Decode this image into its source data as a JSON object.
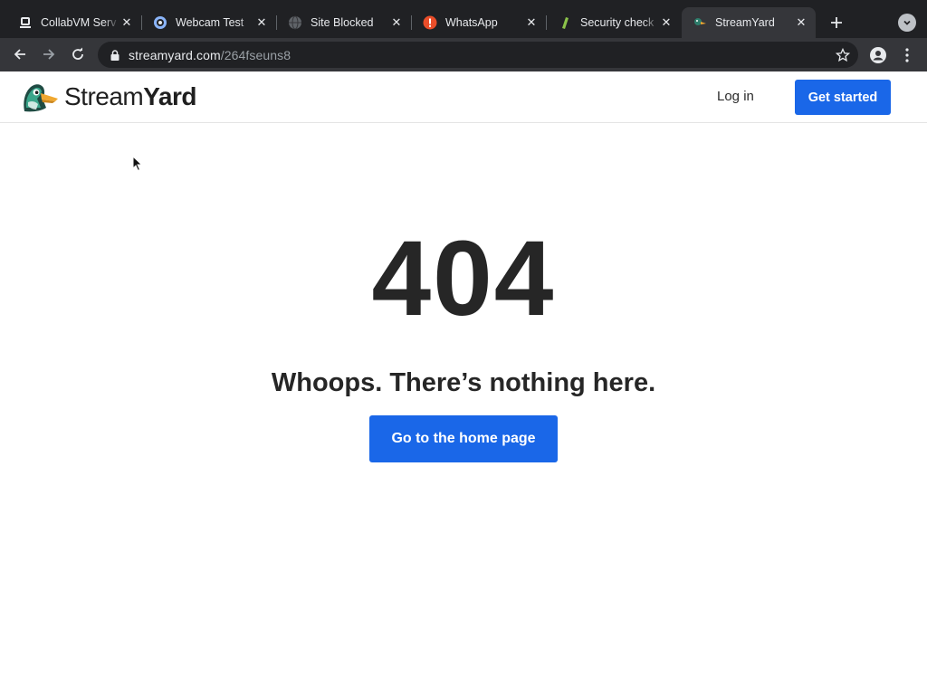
{
  "browser": {
    "tabs": [
      {
        "title": "CollabVM Serv",
        "favicon": "collabvm-icon",
        "active": false
      },
      {
        "title": "Webcam Test",
        "favicon": "webcam-icon",
        "active": false
      },
      {
        "title": "Site Blocked",
        "favicon": "globe-icon",
        "active": false
      },
      {
        "title": "WhatsApp",
        "favicon": "alert-icon",
        "active": false
      },
      {
        "title": "Security check",
        "favicon": "shield-leaf-icon",
        "active": false
      },
      {
        "title": "StreamYard",
        "favicon": "streamyard-icon",
        "active": true
      }
    ],
    "url": {
      "domain": "streamyard.com",
      "path": "/264fseuns8"
    }
  },
  "site": {
    "logo_text_regular": "Stream",
    "logo_text_bold": "Yard",
    "login_label": "Log in",
    "get_started_label": "Get started"
  },
  "main": {
    "error_code": "404",
    "message": "Whoops. There’s nothing here.",
    "home_button_label": "Go to the home page"
  },
  "colors": {
    "accent": "#1a67e8",
    "tabstrip": "#202124",
    "toolbar": "#35363a",
    "text": "#262626"
  }
}
